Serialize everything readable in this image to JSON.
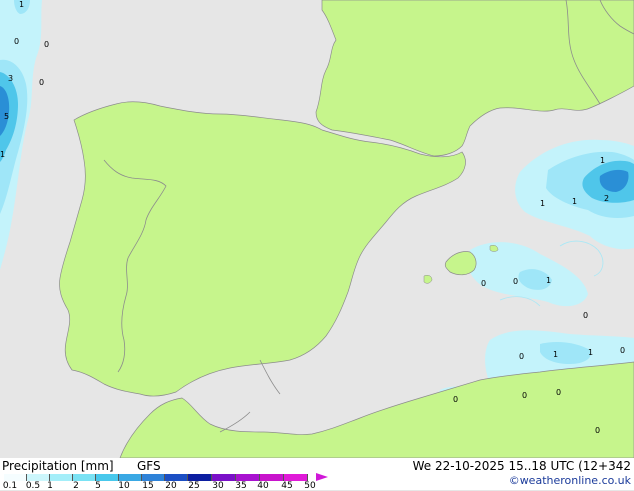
{
  "map": {
    "colors": {
      "sea": "#e6e6e6",
      "land": "#c6f58c",
      "border": "#8c8c8c",
      "precip_light": "#c4f3fb",
      "precip_mid": "#9fe6f8",
      "precip_strong": "#4fc6ea",
      "precip_heavy": "#2a8fd6"
    },
    "contour_labels": [
      "1",
      "0",
      "0",
      "3",
      "0",
      "5",
      "1",
      "1",
      "1",
      "1",
      "2",
      "1",
      "0",
      "0",
      "0",
      "0",
      "1",
      "1",
      "0",
      "0",
      "0",
      "0",
      "0"
    ]
  },
  "footer": {
    "legend_title": "Precipitation [mm]",
    "model": "GFS",
    "valid_time": "We 22-10-2025 15..18 UTC (12+342",
    "credit": "©weatheronline.co.uk"
  },
  "legend": {
    "ticks": [
      "0.1",
      "0.5",
      "1",
      "2",
      "5",
      "10",
      "15",
      "20",
      "25",
      "30",
      "35",
      "40",
      "45",
      "50"
    ],
    "colors": [
      "#f5fdff",
      "#ccf6fc",
      "#a4eef9",
      "#7ae2f4",
      "#48c8ec",
      "#3aa8e4",
      "#2e82d8",
      "#1c4fc4",
      "#0c1ea0",
      "#7a10c8",
      "#a812d0",
      "#c814cc",
      "#e01ad8"
    ]
  }
}
